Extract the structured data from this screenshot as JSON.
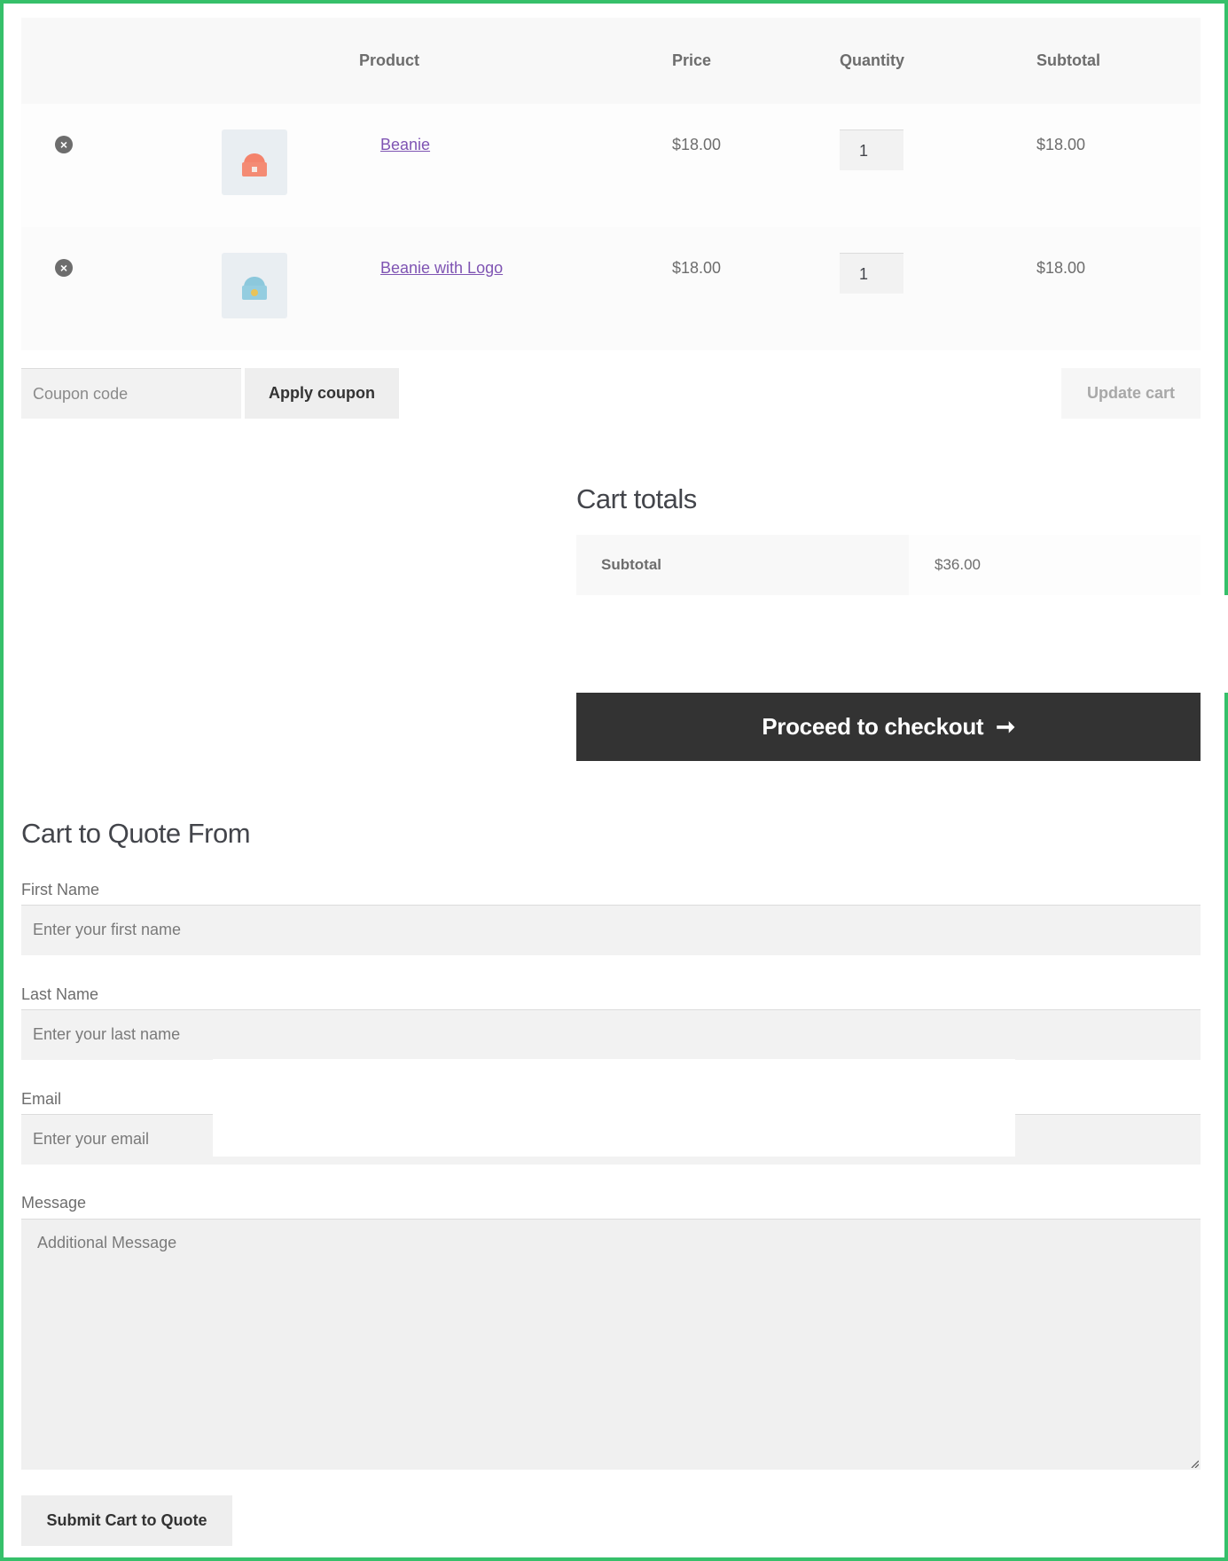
{
  "cart": {
    "columns": [
      "",
      "",
      "Product",
      "Price",
      "Quantity",
      "Subtotal"
    ],
    "rows": [
      {
        "remove_icon": "×",
        "thumbnail": "beanie-orange",
        "product": "Beanie",
        "price": "$18.00",
        "quantity": "1",
        "subtotal": "$18.00"
      },
      {
        "remove_icon": "×",
        "thumbnail": "beanie-blue-logo",
        "product": "Beanie with Logo",
        "price": "$18.00",
        "quantity": "1",
        "subtotal": "$18.00"
      }
    ],
    "coupon_placeholder": "Coupon code",
    "apply_coupon_label": "Apply coupon",
    "update_cart_label": "Update cart"
  },
  "totals": {
    "title": "Cart totals",
    "subtotal_label": "Subtotal",
    "subtotal_value": "$36.00",
    "checkout_label": "Proceed to checkout",
    "checkout_arrow": "➞"
  },
  "quote_form": {
    "title": "Cart to Quote From",
    "fields": [
      {
        "label": "First Name",
        "placeholder": "Enter your first name"
      },
      {
        "label": "Last Name",
        "placeholder": "Enter your last name"
      },
      {
        "label": "Email",
        "placeholder": "Enter your email"
      },
      {
        "label": "Message",
        "placeholder": "Additional Message"
      }
    ],
    "submit_label": "Submit Cart to Quote"
  },
  "colors": {
    "frame": "#36c06a",
    "link": "#7f54b3",
    "checkout_bg": "#333333"
  }
}
